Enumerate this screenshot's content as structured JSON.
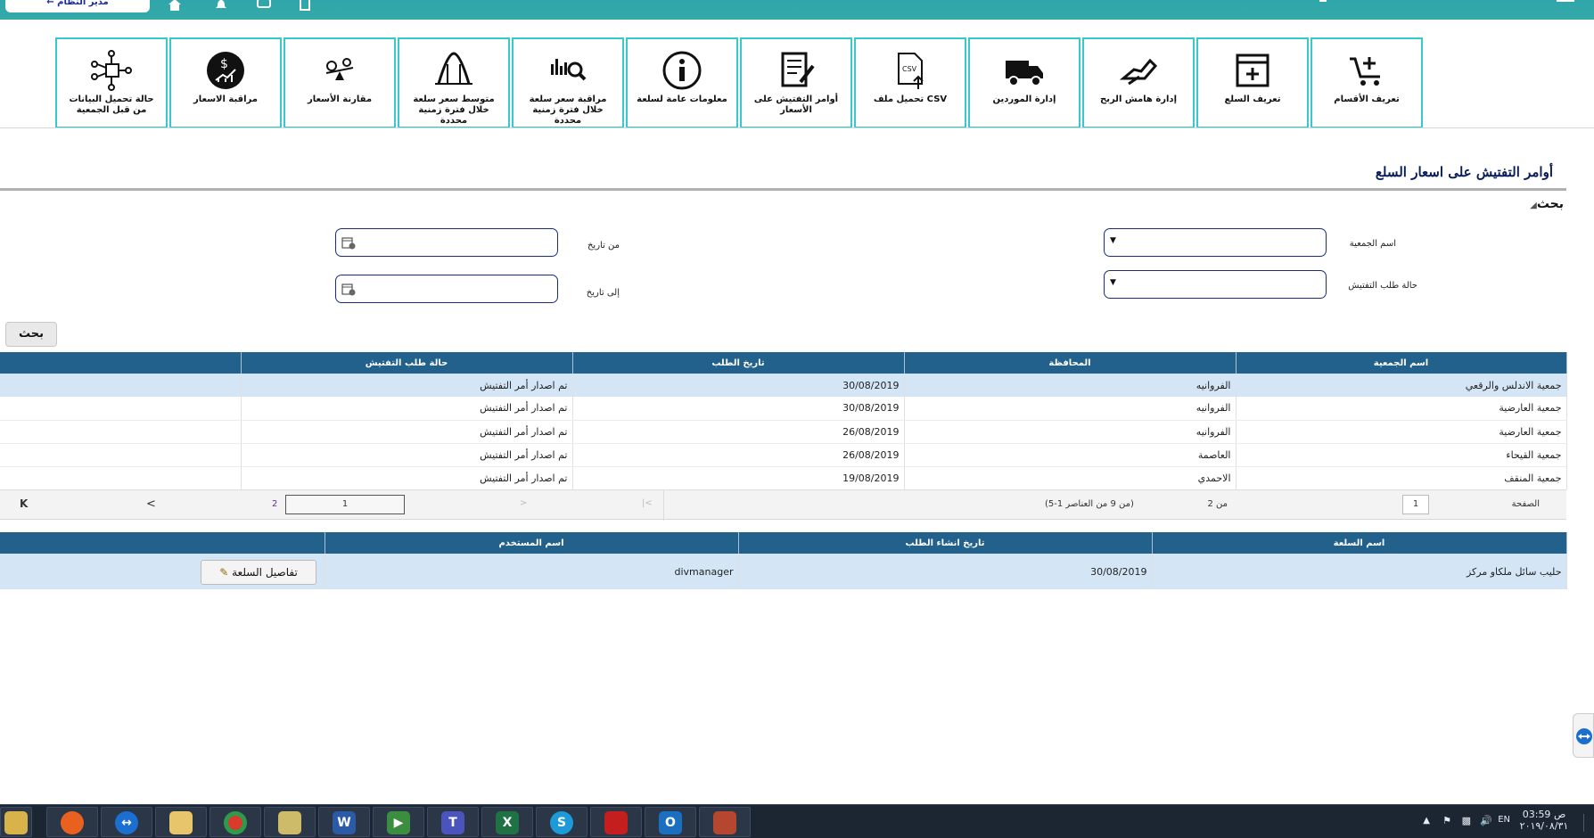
{
  "topbar": {
    "user_label": "← مدير النظام",
    "icons": [
      "home-icon",
      "bell-icon",
      "chat-icon",
      "clipboard-icon"
    ]
  },
  "toolbar": {
    "items": [
      {
        "label": "تعريف الأقسام",
        "icon": "cart-plus-icon"
      },
      {
        "label": "تعريف السلع",
        "icon": "add-window-icon"
      },
      {
        "label": "إدارة هامش الربح",
        "icon": "hand-money-icon"
      },
      {
        "label": "إدارة الموردين",
        "icon": "truck-icon"
      },
      {
        "label": "تحميل ملف CSV",
        "icon": "csv-upload-icon"
      },
      {
        "label": "أوامر التفتيش على الأسعار",
        "icon": "checklist-icon"
      },
      {
        "label": "معلومات عامة لسلعة",
        "icon": "info-icon"
      },
      {
        "label": "مراقبة سعر سلعة خلال فترة زمنية محددة",
        "icon": "chart-search-icon"
      },
      {
        "label": "متوسط سعر سلعة خلال فترة زمنية محددة",
        "icon": "bell-curve-icon"
      },
      {
        "label": "مقارنة الأسعار",
        "icon": "scale-icon"
      },
      {
        "label": "مراقبة الاسعار",
        "icon": "dollar-growth-icon"
      },
      {
        "label": "حالة تحميل البيانات من قبل الجمعية",
        "icon": "network-icon"
      }
    ]
  },
  "page": {
    "title": "أوامر التفتيش على اسعار السلع",
    "search_toggle": "بحث"
  },
  "search": {
    "association_label": "اسم الجمعية",
    "status_label": "حالة طلب التفتيش",
    "from_label": "من تاريخ",
    "to_label": "إلى تاريخ",
    "association_value": "",
    "status_value": "",
    "from_value": "",
    "to_value": "",
    "button": "بحث"
  },
  "orders_table": {
    "headers": [
      "اسم الجمعية",
      "المحافظة",
      "تاريخ الطلب",
      "حالة طلب التفتيش",
      ""
    ],
    "rows": [
      [
        "جمعية الاندلس والرقعي",
        "الفروانيه",
        "30/08/2019",
        "تم اصدار أمر التفتيش"
      ],
      [
        "جمعية العارضية",
        "الفروانيه",
        "30/08/2019",
        "تم اصدار أمر التفتيش"
      ],
      [
        "جمعية العارضية",
        "الفروانيه",
        "26/08/2019",
        "تم اصدار أمر التفتيش"
      ],
      [
        "جمعية القيحاء",
        "العاصمة",
        "26/08/2019",
        "تم اصدار أمر التفتيش"
      ],
      [
        "جمعية المنقف",
        "الاحمدي",
        "19/08/2019",
        "تم اصدار أمر التفتيش"
      ]
    ]
  },
  "pager": {
    "page_label": "الصفحة",
    "current_page": "1",
    "of_total": "من 2",
    "range_text": "(5-1 من 9 من العناصر)",
    "page_input": "1",
    "page_link_2": "2",
    "prev_glyph": "<",
    "last_glyph": "K"
  },
  "items_table": {
    "headers": [
      "اسم السلعة",
      "تاريخ انشاء الطلب",
      "اسم المستخدم",
      ""
    ],
    "rows": [
      [
        "حليب سائل ملكاو مركز",
        "30/08/2019",
        "divmanager",
        "تفاصيل السلعة"
      ]
    ]
  },
  "taskbar": {
    "apps": [
      "file-explorer-icon",
      "firefox-icon",
      "teamviewer-icon",
      "folder-icon",
      "chrome-icon",
      "project-icon",
      "word-icon",
      "media-icon",
      "teams-icon",
      "excel-icon",
      "skype-icon",
      "acrobat-icon",
      "outlook-icon",
      "app-icon"
    ],
    "time": "03:59 ص",
    "date": "٢٠١٩/٠٨/٣١"
  },
  "colors": {
    "topbar": "#2fa6ab",
    "header": "#22618c",
    "selected_row": "#d4e6f6",
    "tool_border": "#35c9c9",
    "taskbar": "#1c2532"
  }
}
